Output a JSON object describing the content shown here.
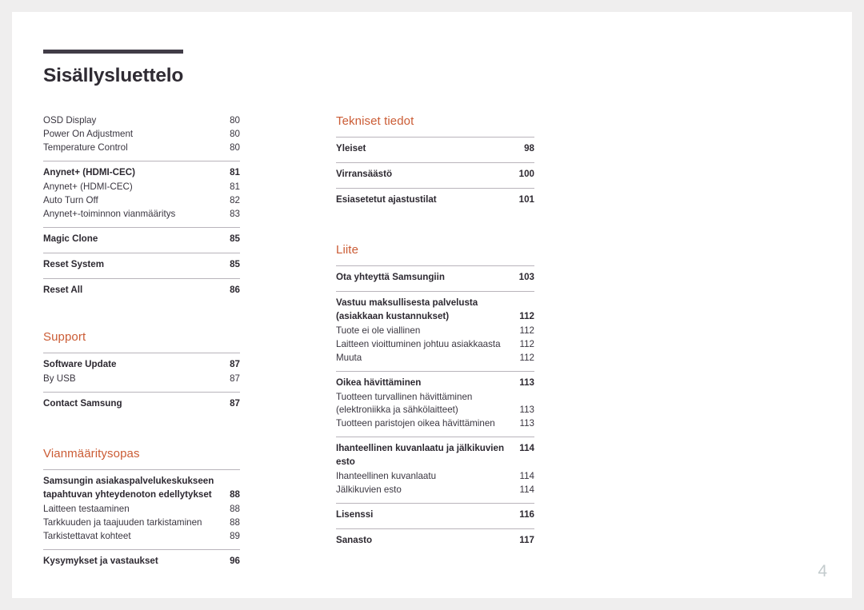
{
  "document": {
    "title": "Sisällysluettelo",
    "page_number": "4",
    "accent_color": "#cb5c35",
    "title_rule_color": "#413c47",
    "text_color": "#3a3640",
    "page_number_color": "#c3cbcd"
  },
  "left_column": {
    "groups": [
      {
        "ruled": false,
        "rows": [
          {
            "label": "OSD Display",
            "page": "80",
            "bold": false
          },
          {
            "label": "Power On Adjustment",
            "page": "80",
            "bold": false
          },
          {
            "label": "Temperature Control",
            "page": "80",
            "bold": false
          }
        ]
      },
      {
        "ruled": true,
        "rows": [
          {
            "label": "Anynet+ (HDMI-CEC)",
            "page": "81",
            "bold": true
          },
          {
            "label": "Anynet+ (HDMI-CEC)",
            "page": "81",
            "bold": false
          },
          {
            "label": "Auto Turn Off",
            "page": "82",
            "bold": false
          },
          {
            "label": "Anynet+-toiminnon vianmääritys",
            "page": "83",
            "bold": false
          }
        ]
      },
      {
        "ruled": true,
        "rows": [
          {
            "label": "Magic Clone",
            "page": "85",
            "bold": true
          }
        ]
      },
      {
        "ruled": true,
        "rows": [
          {
            "label": "Reset System",
            "page": "85",
            "bold": true
          }
        ]
      },
      {
        "ruled": true,
        "rows": [
          {
            "label": "Reset All",
            "page": "86",
            "bold": true
          }
        ]
      }
    ],
    "section_support": {
      "heading": "Support",
      "groups": [
        {
          "rows": [
            {
              "label": "Software Update",
              "page": "87",
              "bold": true
            },
            {
              "label": "By USB",
              "page": "87",
              "bold": false
            }
          ]
        },
        {
          "rows": [
            {
              "label": "Contact Samsung",
              "page": "87",
              "bold": true
            }
          ]
        }
      ]
    },
    "section_troubleshooting": {
      "heading": "Vianmääritysopas",
      "groups": [
        {
          "rows": [
            {
              "label": "Samsungin asiakaspalvelukeskukseen tapahtuvan yhteydenoton edellytykset",
              "page": "88",
              "bold": true,
              "multiline": true
            },
            {
              "label": "Laitteen testaaminen",
              "page": "88",
              "bold": false
            },
            {
              "label": "Tarkkuuden ja taajuuden tarkistaminen",
              "page": "88",
              "bold": false
            },
            {
              "label": "Tarkistettavat kohteet",
              "page": "89",
              "bold": false
            }
          ]
        },
        {
          "rows": [
            {
              "label": "Kysymykset ja vastaukset",
              "page": "96",
              "bold": true
            }
          ]
        }
      ]
    }
  },
  "right_column": {
    "section_specs": {
      "heading": "Tekniset tiedot",
      "groups": [
        {
          "rows": [
            {
              "label": "Yleiset",
              "page": "98",
              "bold": true
            }
          ]
        },
        {
          "rows": [
            {
              "label": "Virransäästö",
              "page": "100",
              "bold": true
            }
          ]
        },
        {
          "rows": [
            {
              "label": "Esiasetetut ajastustilat",
              "page": "101",
              "bold": true
            }
          ]
        }
      ]
    },
    "section_appendix": {
      "heading": "Liite",
      "groups": [
        {
          "rows": [
            {
              "label": "Ota yhteyttä Samsungiin",
              "page": "103",
              "bold": true
            }
          ]
        },
        {
          "rows": [
            {
              "label": "Vastuu maksullisesta palvelusta (asiakkaan kustannukset)",
              "page": "112",
              "bold": true,
              "multiline": true
            },
            {
              "label": "Tuote ei ole viallinen",
              "page": "112",
              "bold": false
            },
            {
              "label": "Laitteen vioittuminen johtuu asiakkaasta",
              "page": "112",
              "bold": false
            },
            {
              "label": "Muuta",
              "page": "112",
              "bold": false
            }
          ]
        },
        {
          "rows": [
            {
              "label": "Oikea hävittäminen",
              "page": "113",
              "bold": true
            },
            {
              "label": "Tuotteen turvallinen hävittäminen (elektroniikka ja sähkölaitteet)",
              "page": "113",
              "bold": false,
              "multiline": true
            },
            {
              "label": "Tuotteen paristojen oikea hävittäminen",
              "page": "113",
              "bold": false
            }
          ]
        },
        {
          "rows": [
            {
              "label": "Ihanteellinen kuvanlaatu ja jälkikuvien esto",
              "page": "114",
              "bold": true,
              "wide": true
            },
            {
              "label": "Ihanteellinen kuvanlaatu",
              "page": "114",
              "bold": false
            },
            {
              "label": "Jälkikuvien esto",
              "page": "114",
              "bold": false
            }
          ]
        },
        {
          "rows": [
            {
              "label": "Lisenssi",
              "page": "116",
              "bold": true
            }
          ]
        },
        {
          "rows": [
            {
              "label": "Sanasto",
              "page": "117",
              "bold": true
            }
          ]
        }
      ]
    }
  }
}
